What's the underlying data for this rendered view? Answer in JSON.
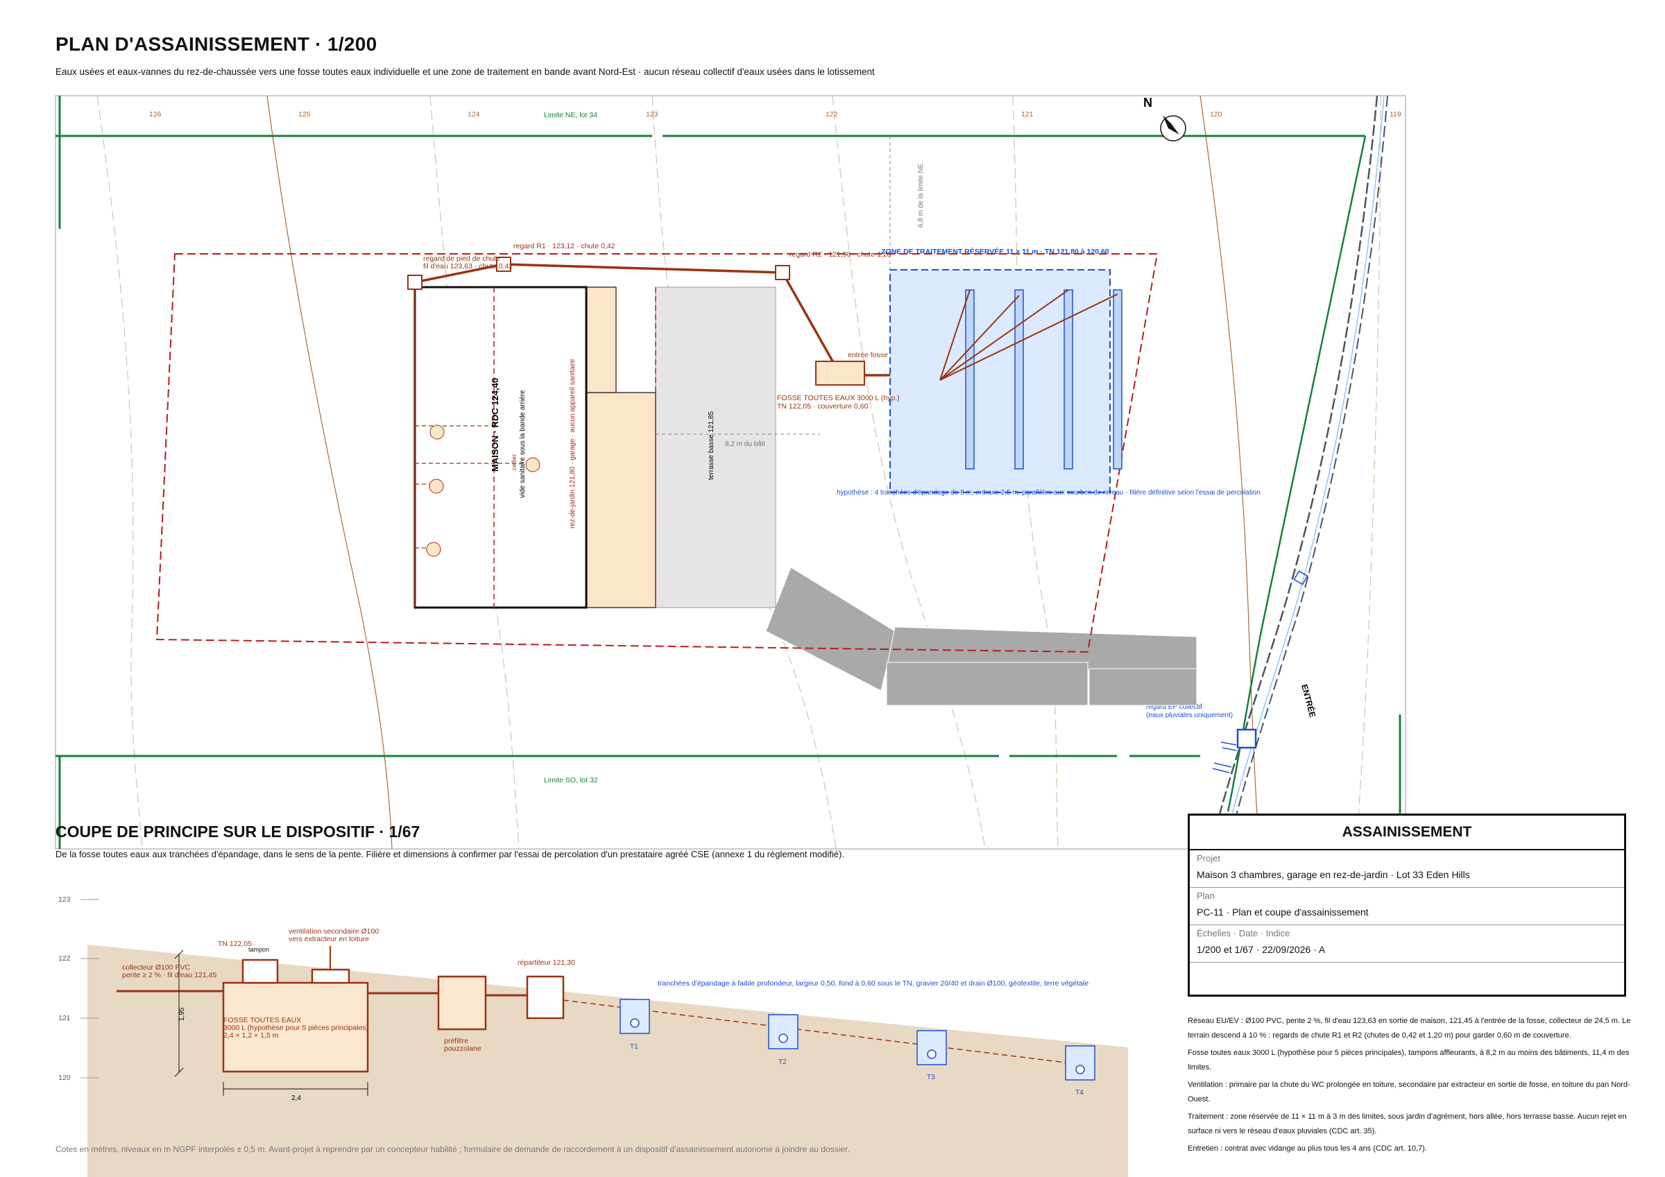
{
  "header": {
    "title": "PLAN D'ASSAINISSEMENT · 1/200",
    "subtitle": "Eaux usées et eaux-vannes du rez-de-chaussée vers une fosse toutes eaux individuelle et une zone de traitement en bande avant Nord-Est · aucun réseau collectif d'eaux usées dans le lotissement"
  },
  "plan": {
    "contours": [
      "126",
      "125",
      "124",
      "123",
      "122",
      "121",
      "120",
      "119"
    ],
    "limit_ne": "Limite NE, lot 34",
    "limit_so": "Limite SO, lot 32",
    "north": "N",
    "dist_ne": "6,8 m de la limite NE",
    "regard_pied": "regard de pied de chute",
    "regard_pied_fe": "fil d'eau 123,63 · chute 0,42",
    "regard_r1": "regard R1 · 123,12 · chute 0,42",
    "regard_r2": "regard R2 · 121,90 · chute 1,20",
    "zone_title": "ZONE DE TRAITEMENT RÉSERVÉE 11 × 11 m · TN 121,80 à 120,60",
    "entree_fosse": "entrée fosse",
    "fosse_line1": "FOSSE TOUTES EAUX 3000 L (hyp.)",
    "fosse_line2": "TN 122,05 · couverture 0,60",
    "maison": "MAISON · RDC 124,40",
    "vide_sanitaire": "vide sanitaire sous la bande arrière",
    "cellier": "cellier",
    "garage": "rez-de-jardin 121,80 · garage · aucun appareil sanitaire",
    "terrasse": "terrasse basse 121,85",
    "dist_bati": "8,2 m du bâti",
    "hypothese": "hypothèse : 4 tranchées d'épandage de 8 m, entraxe 2,5 m, parallèles aux courbes de niveau · filière définitive selon l'essai de percolation",
    "regard_ep_1": "regard EP collectif",
    "regard_ep_2": "(eaux pluviales uniquement)",
    "entree": "ENTRÉE"
  },
  "section": {
    "title": "COUPE DE PRINCIPE SUR LE DISPOSITIF · 1/67",
    "subtitle": "De la fosse toutes eaux aux tranchées d'épandage, dans le sens de la pente. Filière et dimensions à confirmer par l'essai de percolation d'un prestataire agréé CSE (annexe 1 du règlement modifié).",
    "levels": [
      "123",
      "122",
      "121",
      "120"
    ],
    "collecteur_1": "collecteur Ø100 PVC",
    "collecteur_2": "pente ≥ 2 % · fil d'eau 121,45",
    "tn": "TN 122,05",
    "tampon": "tampon",
    "ventilation_1": "ventilation secondaire Ø100",
    "ventilation_2": "vers extracteur en toiture",
    "repartiteur": "répartiteur 121,30",
    "tranchees": "tranchées d'épandage à faible profondeur, largeur 0,50, fond à 0,60 sous le TN, gravier 20/40 et drain Ø100, géotextile, terre végétale",
    "fosse_1": "FOSSE TOUTES EAUX",
    "fosse_2": "3000 L (hypothèse pour 5 pièces principales)",
    "fosse_3": "2,4 × 1,2 × 1,5 m",
    "prefiltre_1": "préfiltre",
    "prefiltre_2": "pouzzolane",
    "depth": "1,95",
    "width": "2,4",
    "trenches": [
      "T1",
      "T2",
      "T3",
      "T4"
    ],
    "footnote": "Cotes en mètres, niveaux en m NGPF interpolés ± 0,5 m. Avant-projet à reprendre par un concepteur habilité ; formulaire de demande de raccordement à un dispositif d'assainissement autonome à joindre au dossier."
  },
  "cartouche": {
    "title": "ASSAINISSEMENT",
    "projet_label": "Projet",
    "projet": "Maison 3 chambres, garage en rez-de-jardin · Lot 33 Eden Hills",
    "plan_label": "Plan",
    "plan": "PC-11 · Plan et coupe d'assainissement",
    "echelle_label": "Échelles · Date · Indice",
    "echelle": "1/200 et 1/67 · 22/09/2026 · A"
  },
  "notes": [
    "Réseau EU/EV : Ø100 PVC, pente 2 %, fil d'eau 123,63 en sortie de maison, 121,45 à l'entrée de la fosse, collecteur de 24,5 m. Le terrain descend à 10 % : regards de chute R1 et R2 (chutes de 0,42 et 1,20 m) pour garder 0,60 m de couverture.",
    "Fosse toutes eaux 3000 L (hypothèse pour 5 pièces principales), tampons affleurants, à 8,2 m au moins des bâtiments, 11,4 m des limites.",
    "Ventilation : primaire par la chute du WC prolongée en toiture, secondaire par extracteur en sortie de fosse, en toiture du pan Nord-Ouest.",
    "Traitement : zone réservée de 11 × 11 m à 3 m des limites, sous jardin d'agrément, hors allée, hors terrasse basse. Aucun rejet en surface ni vers le réseau d'eaux pluviales (CDC art. 35).",
    "Entretien : contrat avec vidange au plus tous les 4 ans (CDC art. 10,7)."
  ],
  "colors": {
    "sewer": "#9a3412",
    "limit": "#15803d",
    "treatment": "#1d4ed8",
    "treatment_fill": "#dbeafe",
    "footprint": "#b91c1c",
    "soil": "#e8d9c4"
  }
}
